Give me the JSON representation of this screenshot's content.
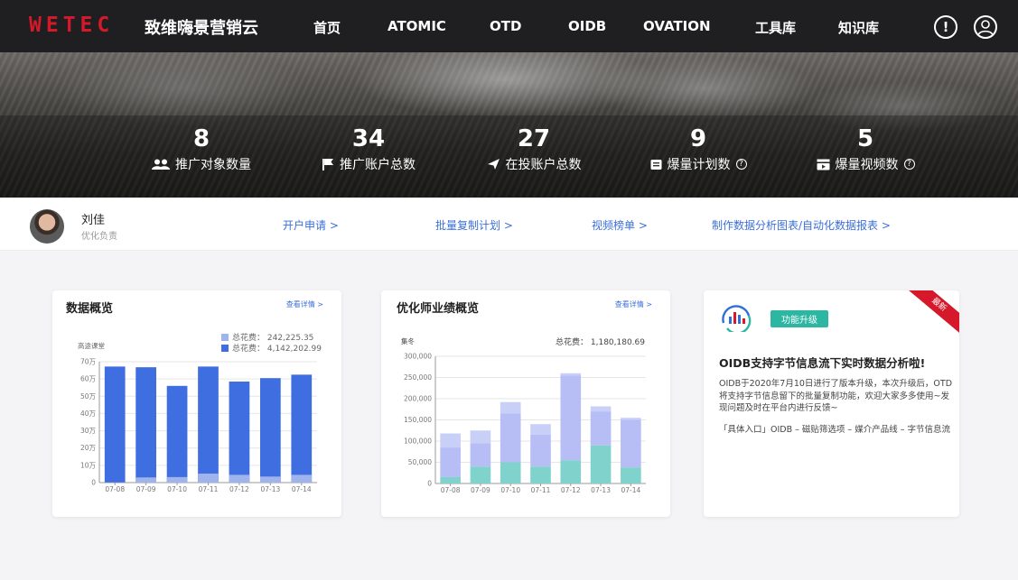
{
  "app": {
    "logo": "WETEC",
    "brand": "致维嗨景营销云"
  },
  "nav": [
    {
      "label": "首页"
    },
    {
      "label": "ATOMIC"
    },
    {
      "label": "OTD"
    },
    {
      "label": "OIDB"
    },
    {
      "label": "OVATION"
    },
    {
      "label": "工具库"
    },
    {
      "label": "知识库"
    }
  ],
  "header_icons": {
    "alert": "!"
  },
  "stats": [
    {
      "value": "8",
      "label": "推广对象数量",
      "icon": "users-icon"
    },
    {
      "value": "34",
      "label": "推广账户总数",
      "icon": "flag-icon"
    },
    {
      "value": "27",
      "label": "在投账户总数",
      "icon": "send-icon"
    },
    {
      "value": "9",
      "label": "爆量计划数",
      "icon": "plan-icon",
      "help": "?"
    },
    {
      "value": "5",
      "label": "爆量视频数",
      "icon": "video-icon",
      "help": "?"
    }
  ],
  "user": {
    "name": "刘佳",
    "role": "优化负责"
  },
  "quick_links": [
    {
      "label": "开户申请 >"
    },
    {
      "label": "批量复制计划 >"
    },
    {
      "label": "视频榜单 >"
    },
    {
      "label": "制作数据分析图表/自动化数据报表 >"
    }
  ],
  "overview": {
    "title": "数据概览",
    "link": "查看详情 >",
    "series_label": "高途课堂",
    "legend": [
      {
        "label": "总花费： 242,225.35",
        "color": "#9fb3ec"
      },
      {
        "label": "总花费： 4,142,202.99",
        "color": "#3f6ee0"
      }
    ],
    "y_ticks": [
      "0",
      "10万",
      "20万",
      "30万",
      "40万",
      "50万",
      "60万",
      "70万"
    ]
  },
  "performance": {
    "title": "优化师业绩概览",
    "link": "查看详情 >",
    "series_label": "集冬",
    "total": "总花费： 1,180,180.69",
    "y_ticks": [
      "0",
      "50,000",
      "100,000",
      "150,000",
      "200,000",
      "250,000",
      "300,000"
    ]
  },
  "promo": {
    "ribbon": "最新",
    "badge": "功能升级",
    "title": "OIDB支持字节信息流下实时数据分析啦!",
    "body": "OIDB于2020年7月10日进行了版本升级，本次升级后，OTD将支持字节信息留下的批量复制功能，欢迎大家多多使用~发现问题及时在平台内进行反馈~",
    "entry": "「具体入口」OIDB – 磁贴筛选项 – 媒介产品线 – 字节信息流"
  },
  "chart_data": [
    {
      "type": "bar",
      "categories": [
        "07-08",
        "07-09",
        "07-10",
        "07-11",
        "07-12",
        "07-13",
        "07-14"
      ],
      "series": [
        {
          "values": [
            1000,
            30000,
            32000,
            52000,
            45000,
            35000,
            45000
          ],
          "color": "#9fb3ec"
        },
        {
          "values": [
            672000,
            668000,
            560000,
            672000,
            585000,
            605000,
            625000
          ],
          "color": "#3f6ee0"
        }
      ],
      "ylim": [
        0,
        700000
      ],
      "y_ticks": [
        "0",
        "10万",
        "20万",
        "30万",
        "40万",
        "50万",
        "60万",
        "70万"
      ]
    },
    {
      "type": "bar",
      "categories": [
        "07-08",
        "07-09",
        "07-10",
        "07-11",
        "07-12",
        "07-13",
        "07-14"
      ],
      "stacked": true,
      "series": [
        {
          "values": [
            15000,
            40000,
            50000,
            40000,
            55000,
            90000,
            38000
          ],
          "color": "#7fd3cc"
        },
        {
          "values": [
            70000,
            55000,
            115000,
            75000,
            200000,
            80000,
            112000
          ],
          "color": "#b7bdf5"
        },
        {
          "values": [
            33000,
            30000,
            27000,
            25000,
            5000,
            12000,
            5000
          ],
          "color": "#c9d0f7"
        }
      ],
      "ylim": [
        0,
        300000
      ],
      "y_ticks": [
        "0",
        "50,000",
        "100,000",
        "150,000",
        "200,000",
        "250,000",
        "300,000"
      ]
    }
  ]
}
